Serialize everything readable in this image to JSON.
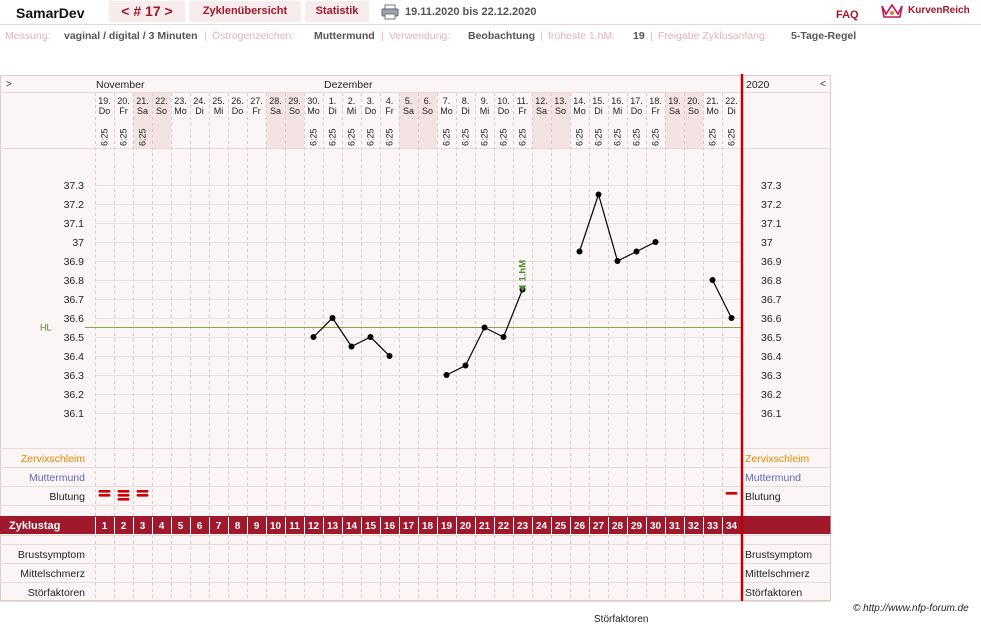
{
  "header": {
    "brand": "SamarDev",
    "cycle_label": "< # 17 >",
    "tab_overview": "Zyklenübersicht",
    "tab_statistics": "Statistik",
    "date_range": "19.11.2020 bis 22.12.2020",
    "faq": "FAQ",
    "logo_text": "KurvenReich"
  },
  "info": {
    "messung_label": "Messung:",
    "messung_value": "vaginal / digital / 3 Minuten",
    "oestrogen_label": "Östrogenzeichen:",
    "oestrogen_value": "Muttermund",
    "verwendung_label": "Verwendung:",
    "verwendung_value": "Beobachtung",
    "hm_label": "früheste 1.hM:",
    "hm_value": "19",
    "freigabe_label": "Freigabe Zyklusanfang:",
    "freigabe_value": "5-Tage-Regel"
  },
  "chart_nav": {
    "left": ">",
    "right": "<",
    "year": "2020"
  },
  "months": [
    {
      "label": "November",
      "day_index": 0
    },
    {
      "label": "Dezember",
      "day_index": 12
    }
  ],
  "days": [
    {
      "date": "19.",
      "wd": "Do",
      "time": "6:25",
      "weekend": false
    },
    {
      "date": "20.",
      "wd": "Fr",
      "time": "6:25",
      "weekend": false
    },
    {
      "date": "21.",
      "wd": "Sa",
      "time": "6:25",
      "weekend": true
    },
    {
      "date": "22.",
      "wd": "So",
      "time": "",
      "weekend": true
    },
    {
      "date": "23.",
      "wd": "Mo",
      "time": "",
      "weekend": false
    },
    {
      "date": "24.",
      "wd": "Di",
      "time": "",
      "weekend": false
    },
    {
      "date": "25.",
      "wd": "Mi",
      "time": "",
      "weekend": false
    },
    {
      "date": "26.",
      "wd": "Do",
      "time": "",
      "weekend": false
    },
    {
      "date": "27.",
      "wd": "Fr",
      "time": "",
      "weekend": false
    },
    {
      "date": "28.",
      "wd": "Sa",
      "time": "",
      "weekend": true
    },
    {
      "date": "29.",
      "wd": "So",
      "time": "",
      "weekend": true
    },
    {
      "date": "30.",
      "wd": "Mo",
      "time": "6:25",
      "weekend": false
    },
    {
      "date": "1.",
      "wd": "Di",
      "time": "6:25",
      "weekend": false
    },
    {
      "date": "2.",
      "wd": "Mi",
      "time": "6:25",
      "weekend": false
    },
    {
      "date": "3.",
      "wd": "Do",
      "time": "6:25",
      "weekend": false
    },
    {
      "date": "4.",
      "wd": "Fr",
      "time": "6:25",
      "weekend": false
    },
    {
      "date": "5.",
      "wd": "Sa",
      "time": "",
      "weekend": true
    },
    {
      "date": "6.",
      "wd": "So",
      "time": "",
      "weekend": true
    },
    {
      "date": "7.",
      "wd": "Mo",
      "time": "6:25",
      "weekend": false
    },
    {
      "date": "8.",
      "wd": "Di",
      "time": "6:25",
      "weekend": false
    },
    {
      "date": "9.",
      "wd": "Mi",
      "time": "6:25",
      "weekend": false
    },
    {
      "date": "10.",
      "wd": "Do",
      "time": "6:25",
      "weekend": false
    },
    {
      "date": "11.",
      "wd": "Fr",
      "time": "6:25",
      "weekend": false
    },
    {
      "date": "12.",
      "wd": "Sa",
      "time": "",
      "weekend": true
    },
    {
      "date": "13.",
      "wd": "So",
      "time": "",
      "weekend": true
    },
    {
      "date": "14.",
      "wd": "Mo",
      "time": "6:25",
      "weekend": false
    },
    {
      "date": "15.",
      "wd": "Di",
      "time": "6:25",
      "weekend": false
    },
    {
      "date": "16.",
      "wd": "Mi",
      "time": "6:25",
      "weekend": false
    },
    {
      "date": "17.",
      "wd": "Do",
      "time": "6:25",
      "weekend": false
    },
    {
      "date": "18.",
      "wd": "Fr",
      "time": "6:25",
      "weekend": false
    },
    {
      "date": "19.",
      "wd": "Sa",
      "time": "",
      "weekend": true
    },
    {
      "date": "20.",
      "wd": "So",
      "time": "",
      "weekend": true
    },
    {
      "date": "21.",
      "wd": "Mo",
      "time": "6:25",
      "weekend": false
    },
    {
      "date": "22.",
      "wd": "Di",
      "time": "6:25",
      "weekend": false
    }
  ],
  "chart_data": {
    "type": "line",
    "ylim": [
      36.0,
      37.4
    ],
    "y_ticks": [
      "37.3",
      "37.2",
      "37.1",
      "37",
      "36.9",
      "36.8",
      "36.7",
      "36.6",
      "36.5",
      "36.4",
      "36.3",
      "36.2",
      "36.1"
    ],
    "hl_label": "HL",
    "hl_value": 36.55,
    "hm_marker": {
      "label": "1.hM",
      "day": 23,
      "value": 36.75
    },
    "segments": [
      [
        {
          "day": 12,
          "t": 36.5
        },
        {
          "day": 13,
          "t": 36.6
        },
        {
          "day": 14,
          "t": 36.45
        },
        {
          "day": 15,
          "t": 36.5
        },
        {
          "day": 16,
          "t": 36.4
        }
      ],
      [
        {
          "day": 19,
          "t": 36.3
        },
        {
          "day": 20,
          "t": 36.35
        },
        {
          "day": 21,
          "t": 36.55
        },
        {
          "day": 22,
          "t": 36.5
        },
        {
          "day": 23,
          "t": 36.75
        }
      ],
      [
        {
          "day": 26,
          "t": 36.95
        },
        {
          "day": 27,
          "t": 37.25
        },
        {
          "day": 28,
          "t": 36.9
        },
        {
          "day": 29,
          "t": 36.95
        },
        {
          "day": 30,
          "t": 37.0
        }
      ],
      [
        {
          "day": 33,
          "t": 36.8
        },
        {
          "day": 34,
          "t": 36.6
        }
      ]
    ]
  },
  "rows": {
    "zervix": "Zervixschleim",
    "muttermund": "Muttermund",
    "blutung": "Blutung",
    "zyklustag": "Zyklustag",
    "brust": "Brustsymptom",
    "mittel": "Mittelschmerz",
    "stoer": "Störfaktoren"
  },
  "bleeding": [
    {
      "day": 1,
      "level": 2
    },
    {
      "day": 2,
      "level": 3
    },
    {
      "day": 3,
      "level": 2
    },
    {
      "day": 34,
      "level": 1
    }
  ],
  "cycle_days": [
    "1",
    "2",
    "3",
    "4",
    "5",
    "6",
    "7",
    "8",
    "9",
    "10",
    "11",
    "12",
    "13",
    "14",
    "15",
    "16",
    "17",
    "18",
    "19",
    "20",
    "21",
    "22",
    "23",
    "24",
    "25",
    "26",
    "27",
    "28",
    "29",
    "30",
    "31",
    "32",
    "33",
    "34"
  ],
  "footer": "© http://www.nfp-forum.de",
  "cutoff_text": "Störfaktoren",
  "colors": {
    "accent": "#a0182b",
    "zervix": "#e68a00",
    "muttermund": "#5a6bb8",
    "hl_line": "#8aa34a",
    "hm": "#4f8f2f",
    "weekend": "#f3e3e3",
    "grid_bg": "#fbf5f5"
  }
}
